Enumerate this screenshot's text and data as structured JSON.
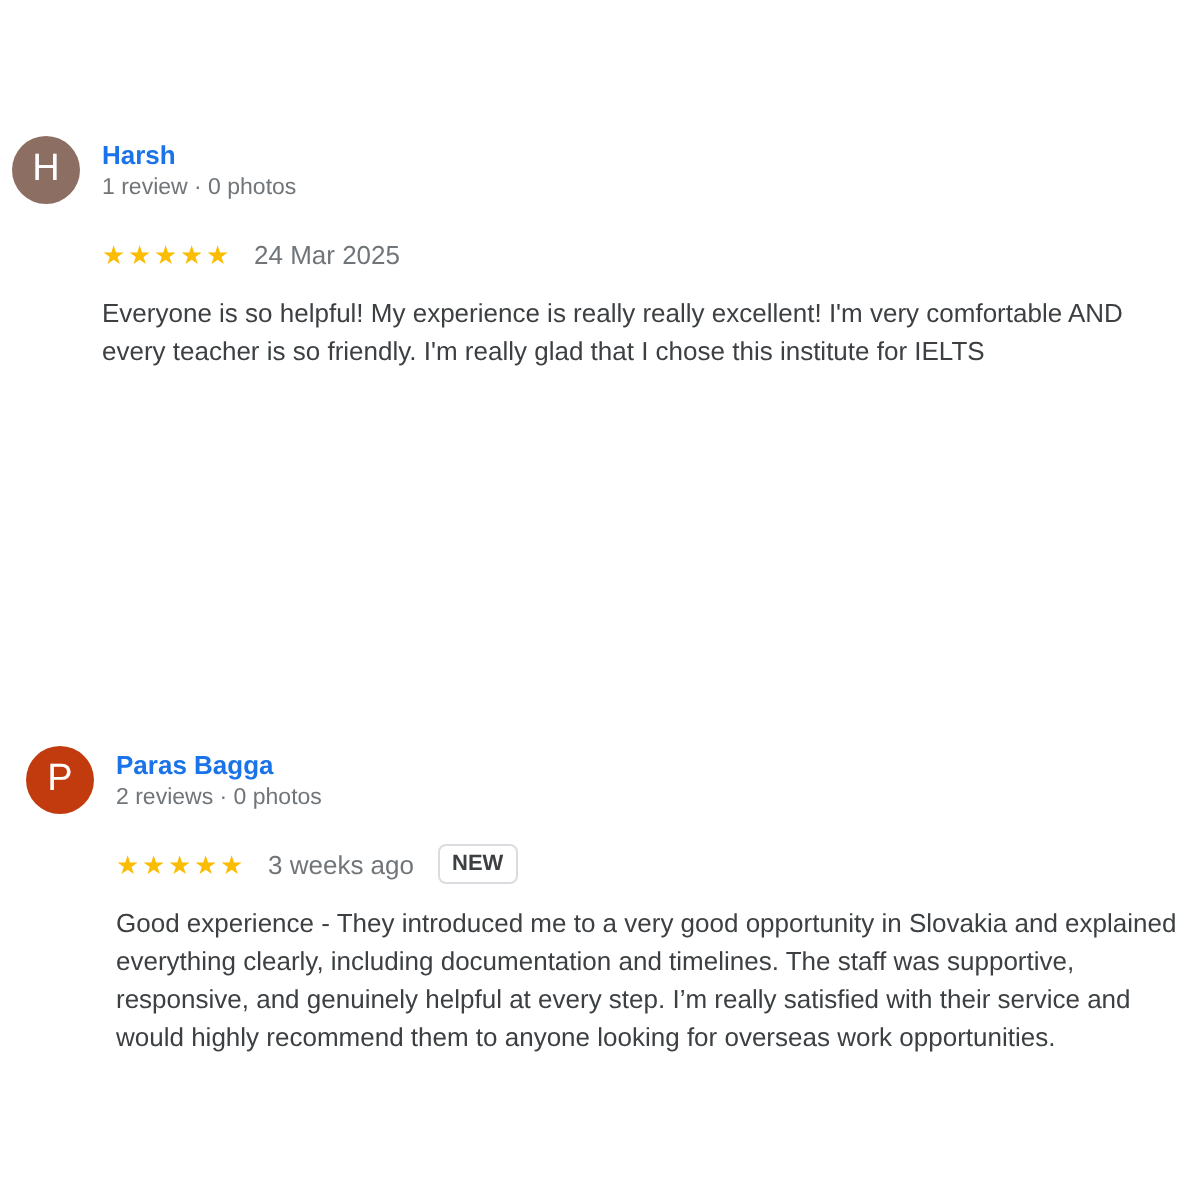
{
  "reviews": [
    {
      "initial": "H",
      "color": "#8d6e63",
      "name": "Harsh",
      "meta": "1 review · 0 photos",
      "stars": 5,
      "date": "24 Mar 2025",
      "text": "Everyone is so helpful! My experience is really really excellent! I'm very comfortable AND every teacher is so friendly. I'm really glad that I chose this institute for IELTS"
    },
    {
      "initial": "P",
      "color": "#c23b0f",
      "name": "Paras Bagga",
      "meta": "2 reviews · 0 photos",
      "stars": 5,
      "date": "3 weeks ago",
      "badge": "NEW",
      "text": "Good experience - They introduced me to a very good opportunity in Slovakia and explained everything clearly, including documentation and timelines. The staff was supportive, responsive, and genuinely helpful at every step. I’m really satisfied with their service and would highly recommend them to anyone looking for overseas work opportunities."
    }
  ]
}
